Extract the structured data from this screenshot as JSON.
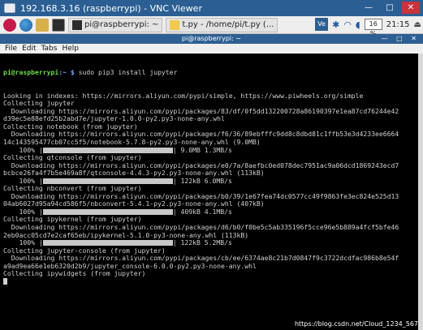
{
  "vnc": {
    "title": "192.168.3.16 (raspberrypi) - VNC Viewer",
    "min": "—",
    "max": "□",
    "close": "✕"
  },
  "taskbar": {
    "tasks": [
      "pi@raspberrypi: ~",
      "t.py - /home/pi/t.py (..."
    ],
    "vnc_badge": "Ve",
    "cpu": "16 %",
    "clock": "21:15"
  },
  "terminal": {
    "title": "pi@raspberrypi: ~",
    "controls": "— □ ✕",
    "menu": [
      "File",
      "Edit",
      "Tabs",
      "Help"
    ],
    "prompt_user": "pi@raspberrypi",
    "prompt_path": ":~ $",
    "command": " sudo pip3 install jupyter",
    "lines": [
      "Looking in indexes: https://mirrors.aliyun.com/pypi/simple, https://www.piwheels.org/simple",
      "Collecting jupyter",
      "  Downloading https://mirrors.aliyun.com/pypi/packages/83/df/0f5dd132200728a86190397e1ea87cd76244e42",
      "d39ec5e88efd25b2abd7e/jupyter-1.0.0-py2.py3-none-any.whl",
      "Collecting notebook (from jupyter)",
      "  Downloading https://mirrors.aliyun.com/pypi/packages/f6/36/89ebfffc9dd8c8dbd81c1ffb53e3d4233ee6664",
      "14c143595477cb07cc5f5/notebook-5.7.8-py2.py3-none-any.whl (9.0MB)",
      {
        "pct": "    100% |",
        "size": "| 9.0MB 1.3MB/s"
      },
      "Collecting qtconsole (from jupyter)",
      "  Downloading https://mirrors.aliyun.com/pypi/packages/e0/7a/8aefbc0ed078dec7951ac9a06dcd1869243ecd7",
      "bcbce26fa4f7b5e469a8f/qtconsole-4.4.3-py2.py3-none-any.whl (113kB)",
      {
        "pct": "    100% |",
        "size": "| 122kB 6.0MB/s"
      },
      "Collecting nbconvert (from jupyter)",
      "  Downloading https://mirrors.aliyun.com/pypi/packages/b0/39/1e67fea74dc0577cc49f9863fe3ec824e525d13",
      "04ab6027d95a94cd586f5/nbconvert-5.4.1-py2.py3-none-any.whl (407kB)",
      {
        "pct": "    100% |",
        "size": "| 409kB 4.1MB/s"
      },
      "Collecting ipykernel (from jupyter)",
      "  Downloading https://mirrors.aliyun.com/pypi/packages/d6/b0/f0be5c5ab335196f5cce96e5b889a4fcf5bfe46",
      "2eb0acc05cd7e2caf65eb/ipykernel-5.1.0-py3-none-any.whl (113kB)",
      {
        "pct": "    100% |",
        "size": "| 122kB 5.2MB/s"
      },
      "Collecting jupyter-console (from jupyter)",
      "  Downloading https://mirrors.aliyun.com/pypi/packages/cb/ee/6374ae8c21b7d0847f9c3722dcdfac986b8e54f",
      "a9ad9ea66e1eb6320d2b9/jupyter_console-6.0.0-py2.py3-none-any.whl",
      "Collecting ipywidgets (from jupyter)"
    ]
  },
  "watermark": "https://blog.csdn.net/Cloud_1234_567"
}
